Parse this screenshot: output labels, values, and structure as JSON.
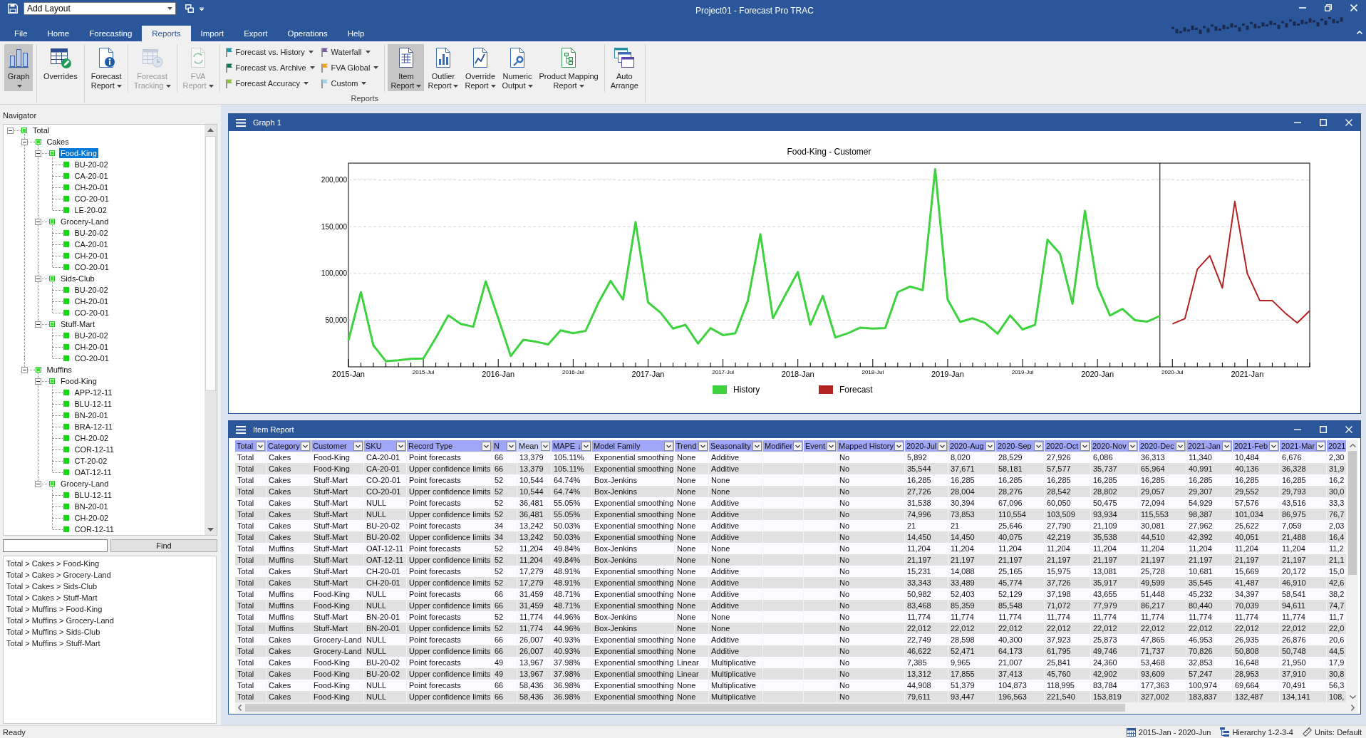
{
  "title_bar": {
    "layout_combo": "Add Layout",
    "title": "Project01 - Forecast Pro TRAC"
  },
  "ribbon": {
    "tabs": [
      {
        "label": "File",
        "selected": false
      },
      {
        "label": "Home",
        "selected": false
      },
      {
        "label": "Forecasting",
        "selected": false
      },
      {
        "label": "Reports",
        "selected": true
      },
      {
        "label": "Import",
        "selected": false
      },
      {
        "label": "Export",
        "selected": false
      },
      {
        "label": "Operations",
        "selected": false
      },
      {
        "label": "Help",
        "selected": false
      }
    ],
    "groups": [
      {
        "sections": [
          [
            {
              "kind": "large",
              "lines": [
                "Graph"
              ],
              "dropdown": true,
              "selected": true,
              "disabled": false
            }
          ]
        ]
      },
      {
        "sections": [
          [
            {
              "kind": "large",
              "lines": [
                "Overrides"
              ],
              "dropdown": false,
              "selected": false,
              "disabled": false
            }
          ]
        ]
      },
      {
        "label": "Reports",
        "sections": [
          [
            {
              "kind": "large",
              "lines": [
                "Forecast",
                "Report"
              ],
              "dropdown": true,
              "selected": false,
              "disabled": false
            }
          ],
          [
            {
              "kind": "large",
              "lines": [
                "Forecast",
                "Tracking"
              ],
              "dropdown": true,
              "selected": false,
              "disabled": true
            }
          ],
          [
            {
              "kind": "large",
              "lines": [
                "FVA",
                "Report"
              ],
              "dropdown": true,
              "selected": false,
              "disabled": true
            }
          ],
          [
            {
              "kind": "stack",
              "entries": [
                {
                  "label": "Forecast vs. History",
                  "color": "#1b9aaa",
                  "dropdown": true
                },
                {
                  "label": "Forecast vs. Archive",
                  "color": "#127a52",
                  "dropdown": true
                },
                {
                  "label": "Forecast Accuracy",
                  "color": "#8cc43c",
                  "dropdown": true
                }
              ]
            },
            {
              "kind": "stack",
              "entries": [
                {
                  "label": "Waterfall",
                  "color": "#7a5aa8",
                  "dropdown": true
                },
                {
                  "label": "FVA Global",
                  "color": "#f2a51f",
                  "dropdown": true
                },
                {
                  "label": "Custom",
                  "color": "#9fd6ea",
                  "dropdown": true
                }
              ]
            }
          ],
          [
            {
              "kind": "large",
              "lines": [
                "Item",
                "Report"
              ],
              "dropdown": true,
              "selected": true,
              "disabled": false
            },
            {
              "kind": "large",
              "lines": [
                "Outlier",
                "Report"
              ],
              "dropdown": true,
              "selected": false,
              "disabled": false
            },
            {
              "kind": "large",
              "lines": [
                "Override",
                "Report"
              ],
              "dropdown": true,
              "selected": false,
              "disabled": false
            },
            {
              "kind": "large",
              "lines": [
                "Numeric",
                "Output"
              ],
              "dropdown": true,
              "selected": false,
              "disabled": false
            },
            {
              "kind": "large",
              "lines": [
                "Product Mapping",
                "Report"
              ],
              "dropdown": true,
              "selected": false,
              "disabled": false
            }
          ],
          [
            {
              "kind": "large",
              "lines": [
                "Auto",
                "Arrange"
              ],
              "dropdown": false,
              "selected": false,
              "disabled": false
            }
          ]
        ]
      }
    ]
  },
  "navigator": {
    "title": "Navigator",
    "tree": [
      {
        "label": "Total",
        "expanded": true,
        "selected": false,
        "children": [
          {
            "label": "Cakes",
            "expanded": true,
            "selected": false,
            "children": [
              {
                "label": "Food-King",
                "expanded": true,
                "selected": true,
                "children": [
                  {
                    "label": "BU-20-02",
                    "selected": false
                  },
                  {
                    "label": "CA-20-01",
                    "selected": false
                  },
                  {
                    "label": "CH-20-01",
                    "selected": false
                  },
                  {
                    "label": "CO-20-01",
                    "selected": false
                  },
                  {
                    "label": "LE-20-02",
                    "selected": false
                  }
                ]
              },
              {
                "label": "Grocery-Land",
                "expanded": true,
                "selected": false,
                "children": [
                  {
                    "label": "BU-20-02",
                    "selected": false
                  },
                  {
                    "label": "CA-20-01",
                    "selected": false
                  },
                  {
                    "label": "CH-20-01",
                    "selected": false
                  },
                  {
                    "label": "CO-20-01",
                    "selected": false
                  }
                ]
              },
              {
                "label": "Sids-Club",
                "expanded": true,
                "selected": false,
                "children": [
                  {
                    "label": "BU-20-02",
                    "selected": false
                  },
                  {
                    "label": "CH-20-01",
                    "selected": false
                  },
                  {
                    "label": "CO-20-01",
                    "selected": false
                  }
                ]
              },
              {
                "label": "Stuff-Mart",
                "expanded": true,
                "selected": false,
                "children": [
                  {
                    "label": "BU-20-02",
                    "selected": false
                  },
                  {
                    "label": "CH-20-01",
                    "selected": false
                  },
                  {
                    "label": "CO-20-01",
                    "selected": false
                  }
                ]
              }
            ]
          },
          {
            "label": "Muffins",
            "expanded": true,
            "selected": false,
            "children": [
              {
                "label": "Food-King",
                "expanded": true,
                "selected": false,
                "children": [
                  {
                    "label": "APP-12-11",
                    "selected": false
                  },
                  {
                    "label": "BLU-12-11",
                    "selected": false
                  },
                  {
                    "label": "BN-20-01",
                    "selected": false
                  },
                  {
                    "label": "BRA-12-11",
                    "selected": false
                  },
                  {
                    "label": "CH-20-02",
                    "selected": false
                  },
                  {
                    "label": "COR-12-11",
                    "selected": false
                  },
                  {
                    "label": "CT-20-02",
                    "selected": false
                  },
                  {
                    "label": "OAT-12-11",
                    "selected": false
                  }
                ]
              },
              {
                "label": "Grocery-Land",
                "expanded": true,
                "selected": false,
                "children": [
                  {
                    "label": "BLU-12-11",
                    "selected": false
                  },
                  {
                    "label": "BN-20-01",
                    "selected": false
                  },
                  {
                    "label": "CH-20-02",
                    "selected": false
                  },
                  {
                    "label": "COR-12-11",
                    "selected": false
                  }
                ]
              }
            ]
          }
        ]
      }
    ],
    "find_button": "Find",
    "paths": [
      "Total > Cakes > Food-King",
      "Total > Cakes > Grocery-Land",
      "Total > Cakes > Sids-Club",
      "Total > Cakes > Stuff-Mart",
      "Total > Muffins > Food-King",
      "Total > Muffins > Grocery-Land",
      "Total > Muffins > Sids-Club",
      "Total > Muffins > Stuff-Mart"
    ]
  },
  "graph": {
    "title": "Graph 1",
    "chart_data": {
      "type": "line",
      "title": "Food-King - Customer",
      "categories": [
        "2015-Jan",
        null,
        null,
        null,
        null,
        null,
        "2015-Jul",
        null,
        null,
        null,
        null,
        null,
        "2016-Jan",
        null,
        null,
        null,
        null,
        null,
        "2016-Jul",
        null,
        null,
        null,
        null,
        null,
        "2017-Jan",
        null,
        null,
        null,
        null,
        null,
        "2017-Jul",
        null,
        null,
        null,
        null,
        null,
        "2018-Jan",
        null,
        null,
        null,
        null,
        null,
        "2018-Jul",
        null,
        null,
        null,
        null,
        null,
        "2019-Jan",
        null,
        null,
        null,
        null,
        null,
        "2019-Jul",
        null,
        null,
        null,
        null,
        null,
        "2020-Jan",
        null,
        null,
        null,
        null,
        null,
        "2020-Jul",
        null,
        null,
        null,
        null,
        null,
        "2021-Jan",
        null,
        null,
        null,
        null,
        null
      ],
      "series": [
        {
          "name": "History",
          "color": "#3ed23e",
          "values": [
            28500,
            80000,
            23000,
            6000,
            7000,
            8500,
            9000,
            31000,
            55000,
            46000,
            43000,
            91500,
            52000,
            11500,
            29000,
            27000,
            24000,
            39000,
            36000,
            38500,
            68000,
            92000,
            72000,
            155000,
            69000,
            58000,
            41000,
            45000,
            25000,
            41500,
            34000,
            36000,
            71000,
            142000,
            52000,
            77000,
            101500,
            45000,
            76000,
            31500,
            36000,
            42000,
            41000,
            41500,
            80000,
            86000,
            82000,
            211500,
            72000,
            48000,
            52000,
            47000,
            35500,
            55000,
            40000,
            45000,
            136000,
            121000,
            67500,
            167000,
            86000,
            55000,
            62000,
            50000,
            48500,
            54500,
            null,
            null,
            null,
            null,
            null,
            null,
            null,
            null,
            null,
            null,
            null,
            null
          ]
        },
        {
          "name": "Forecast",
          "color": "#b22222",
          "values": [
            null,
            null,
            null,
            null,
            null,
            null,
            null,
            null,
            null,
            null,
            null,
            null,
            null,
            null,
            null,
            null,
            null,
            null,
            null,
            null,
            null,
            null,
            null,
            null,
            null,
            null,
            null,
            null,
            null,
            null,
            null,
            null,
            null,
            null,
            null,
            null,
            null,
            null,
            null,
            null,
            null,
            null,
            null,
            null,
            null,
            null,
            null,
            null,
            null,
            null,
            null,
            null,
            null,
            null,
            null,
            null,
            null,
            null,
            null,
            null,
            null,
            null,
            null,
            null,
            null,
            null,
            46000,
            51500,
            104500,
            119000,
            84500,
            177000,
            100000,
            71000,
            71000,
            58000,
            47000,
            60000
          ]
        }
      ],
      "ylim": [
        0,
        218000
      ],
      "yticks": [
        {
          "value": 50000,
          "label": "50,000"
        },
        {
          "value": 100000,
          "label": "100,000"
        },
        {
          "value": 150000,
          "label": "150,000"
        },
        {
          "value": 200000,
          "label": "200,000"
        }
      ],
      "grid": true,
      "legend": "bottom"
    }
  },
  "item_report": {
    "title": "Item Report",
    "columns": [
      {
        "label": "Total",
        "highlighted": false,
        "dropdown": true
      },
      {
        "label": "Category",
        "highlighted": false,
        "dropdown": true
      },
      {
        "label": "Customer",
        "highlighted": false,
        "dropdown": true
      },
      {
        "label": "SKU",
        "highlighted": false,
        "dropdown": true
      },
      {
        "label": "Record Type",
        "highlighted": false,
        "dropdown": true
      },
      {
        "label": "N",
        "highlighted": false,
        "dropdown": true
      },
      {
        "label": "Mean",
        "highlighted": true,
        "dropdown": true
      },
      {
        "label": "MAPE ↓",
        "highlighted": false,
        "dropdown": true
      },
      {
        "label": "Model Family",
        "highlighted": false,
        "dropdown": true
      },
      {
        "label": "Trend",
        "highlighted": false,
        "dropdown": true
      },
      {
        "label": "Seasonality",
        "highlighted": false,
        "dropdown": true
      },
      {
        "label": "Modifier",
        "highlighted": false,
        "dropdown": true
      },
      {
        "label": "Event",
        "highlighted": false,
        "dropdown": true
      },
      {
        "label": "Mapped History",
        "highlighted": false,
        "dropdown": true
      },
      {
        "label": "2020-Jul",
        "highlighted": false,
        "dropdown": true
      },
      {
        "label": "2020-Aug",
        "highlighted": false,
        "dropdown": true
      },
      {
        "label": "2020-Sep",
        "highlighted": false,
        "dropdown": true
      },
      {
        "label": "2020-Oct",
        "highlighted": false,
        "dropdown": true
      },
      {
        "label": "2020-Nov",
        "highlighted": false,
        "dropdown": true
      },
      {
        "label": "2020-Dec",
        "highlighted": false,
        "dropdown": true
      },
      {
        "label": "2021-Jan",
        "highlighted": false,
        "dropdown": true
      },
      {
        "label": "2021-Feb",
        "highlighted": false,
        "dropdown": true
      },
      {
        "label": "2021-Mar",
        "highlighted": false,
        "dropdown": true
      },
      {
        "label": "2021",
        "highlighted": false,
        "dropdown": false
      }
    ],
    "rows": [
      [
        "Total",
        "Cakes",
        "Food-King",
        "CA-20-01",
        "Point forecasts",
        "66",
        "13,379",
        "105.11%",
        "Exponential smoothing",
        "None",
        "Additive",
        null,
        null,
        "No",
        "5,892",
        "8,020",
        "28,529",
        "27,926",
        "6,086",
        "36,313",
        "11,340",
        "10,484",
        "6,676",
        "2,30"
      ],
      [
        "Total",
        "Cakes",
        "Food-King",
        "CA-20-01",
        "Upper confidence limits",
        "66",
        "13,379",
        "105.11%",
        "Exponential smoothing",
        "None",
        "Additive",
        null,
        null,
        "No",
        "35,544",
        "37,671",
        "58,181",
        "57,577",
        "35,737",
        "65,964",
        "40,991",
        "40,136",
        "36,328",
        "31,9"
      ],
      [
        "Total",
        "Cakes",
        "Stuff-Mart",
        "CO-20-01",
        "Point forecasts",
        "52",
        "10,544",
        "64.74%",
        "Box-Jenkins",
        "None",
        "None",
        null,
        null,
        "No",
        "16,285",
        "16,285",
        "16,285",
        "16,285",
        "16,285",
        "16,285",
        "16,285",
        "16,285",
        "16,285",
        "16,2"
      ],
      [
        "Total",
        "Cakes",
        "Stuff-Mart",
        "CO-20-01",
        "Upper confidence limits",
        "52",
        "10,544",
        "64.74%",
        "Box-Jenkins",
        "None",
        "None",
        null,
        null,
        "No",
        "27,726",
        "28,004",
        "28,276",
        "28,542",
        "28,802",
        "29,057",
        "29,307",
        "29,552",
        "29,793",
        "30,0"
      ],
      [
        "Total",
        "Cakes",
        "Stuff-Mart",
        "NULL",
        "Point forecasts",
        "52",
        "36,481",
        "55.05%",
        "Exponential smoothing",
        "None",
        "Additive",
        null,
        null,
        "No",
        "31,538",
        "30,394",
        "67,096",
        "60,050",
        "50,475",
        "72,094",
        "54,929",
        "57,576",
        "43,516",
        "33,3"
      ],
      [
        "Total",
        "Cakes",
        "Stuff-Mart",
        "NULL",
        "Upper confidence limits",
        "52",
        "36,481",
        "55.05%",
        "Exponential smoothing",
        "None",
        "Additive",
        null,
        null,
        "No",
        "74,996",
        "73,853",
        "110,554",
        "103,509",
        "93,934",
        "115,553",
        "98,387",
        "101,034",
        "86,975",
        "76,7"
      ],
      [
        "Total",
        "Cakes",
        "Stuff-Mart",
        "BU-20-02",
        "Point forecasts",
        "34",
        "13,242",
        "50.03%",
        "Exponential smoothing",
        "None",
        "Additive",
        null,
        null,
        "No",
        "21",
        "21",
        "25,646",
        "27,790",
        "21,109",
        "30,081",
        "27,962",
        "25,622",
        "7,059",
        "2,03"
      ],
      [
        "Total",
        "Cakes",
        "Stuff-Mart",
        "BU-20-02",
        "Upper confidence limits",
        "34",
        "13,242",
        "50.03%",
        "Exponential smoothing",
        "None",
        "Additive",
        null,
        null,
        "No",
        "14,450",
        "14,450",
        "40,075",
        "42,219",
        "35,538",
        "44,510",
        "42,392",
        "40,051",
        "21,488",
        "16,4"
      ],
      [
        "Total",
        "Muffins",
        "Stuff-Mart",
        "OAT-12-11",
        "Point forecasts",
        "52",
        "11,204",
        "49.84%",
        "Box-Jenkins",
        "None",
        "None",
        null,
        null,
        "No",
        "11,204",
        "11,204",
        "11,204",
        "11,204",
        "11,204",
        "11,204",
        "11,204",
        "11,204",
        "11,204",
        "11,2"
      ],
      [
        "Total",
        "Muffins",
        "Stuff-Mart",
        "OAT-12-11",
        "Upper confidence limits",
        "52",
        "11,204",
        "49.84%",
        "Box-Jenkins",
        "None",
        "None",
        null,
        null,
        "No",
        "21,197",
        "21,197",
        "21,197",
        "21,197",
        "21,197",
        "21,197",
        "21,197",
        "21,197",
        "21,197",
        "21,1"
      ],
      [
        "Total",
        "Cakes",
        "Stuff-Mart",
        "CH-20-01",
        "Point forecasts",
        "52",
        "17,279",
        "48.91%",
        "Exponential smoothing",
        "None",
        "Additive",
        null,
        null,
        "No",
        "15,231",
        "14,088",
        "25,165",
        "15,975",
        "13,081",
        "25,728",
        "10,681",
        "15,669",
        "20,172",
        "15,0"
      ],
      [
        "Total",
        "Cakes",
        "Stuff-Mart",
        "CH-20-01",
        "Upper confidence limits",
        "52",
        "17,279",
        "48.91%",
        "Exponential smoothing",
        "None",
        "Additive",
        null,
        null,
        "No",
        "33,343",
        "33,489",
        "45,774",
        "37,726",
        "35,917",
        "49,599",
        "35,545",
        "41,487",
        "46,910",
        "42,6"
      ],
      [
        "Total",
        "Muffins",
        "Food-King",
        "NULL",
        "Point forecasts",
        "66",
        "31,459",
        "48.71%",
        "Exponential smoothing",
        "None",
        "Additive",
        null,
        null,
        "No",
        "50,982",
        "52,403",
        "52,129",
        "37,198",
        "43,655",
        "51,448",
        "45,232",
        "34,397",
        "58,541",
        "38,2"
      ],
      [
        "Total",
        "Muffins",
        "Food-King",
        "NULL",
        "Upper confidence limits",
        "66",
        "31,459",
        "48.71%",
        "Exponential smoothing",
        "None",
        "Additive",
        null,
        null,
        "No",
        "83,468",
        "85,359",
        "85,548",
        "71,072",
        "77,979",
        "86,217",
        "80,440",
        "70,039",
        "94,611",
        "74,7"
      ],
      [
        "Total",
        "Muffins",
        "Stuff-Mart",
        "BN-20-01",
        "Point forecasts",
        "52",
        "11,774",
        "44.96%",
        "Box-Jenkins",
        "None",
        "None",
        null,
        null,
        "No",
        "11,774",
        "11,774",
        "11,774",
        "11,774",
        "11,774",
        "11,774",
        "11,774",
        "11,774",
        "11,774",
        "11,7"
      ],
      [
        "Total",
        "Muffins",
        "Stuff-Mart",
        "BN-20-01",
        "Upper confidence limits",
        "52",
        "11,774",
        "44.96%",
        "Box-Jenkins",
        "None",
        "None",
        null,
        null,
        "No",
        "22,012",
        "22,012",
        "22,012",
        "22,012",
        "22,012",
        "22,012",
        "22,012",
        "22,012",
        "22,012",
        "22,0"
      ],
      [
        "Total",
        "Cakes",
        "Grocery-Land",
        "NULL",
        "Point forecasts",
        "66",
        "26,007",
        "40.93%",
        "Exponential smoothing",
        "None",
        "Additive",
        null,
        null,
        "No",
        "22,749",
        "28,598",
        "40,300",
        "37,923",
        "25,873",
        "47,865",
        "46,953",
        "26,935",
        "26,876",
        "20,6"
      ],
      [
        "Total",
        "Cakes",
        "Grocery-Land",
        "NULL",
        "Upper confidence limits",
        "66",
        "26,007",
        "40.93%",
        "Exponential smoothing",
        "None",
        "Additive",
        null,
        null,
        "No",
        "46,622",
        "52,471",
        "64,173",
        "61,795",
        "49,746",
        "71,737",
        "70,826",
        "50,808",
        "50,748",
        "44,5"
      ],
      [
        "Total",
        "Cakes",
        "Food-King",
        "BU-20-02",
        "Point forecasts",
        "49",
        "13,967",
        "37.98%",
        "Exponential smoothing",
        "Linear",
        "Multiplicative",
        null,
        null,
        "No",
        "7,385",
        "9,965",
        "21,007",
        "25,841",
        "24,360",
        "53,468",
        "32,853",
        "16,648",
        "21,950",
        "17,9"
      ],
      [
        "Total",
        "Cakes",
        "Food-King",
        "BU-20-02",
        "Upper confidence limits",
        "49",
        "13,967",
        "37.98%",
        "Exponential smoothing",
        "Linear",
        "Multiplicative",
        null,
        null,
        "No",
        "13,312",
        "17,855",
        "37,413",
        "45,760",
        "42,902",
        "93,609",
        "57,247",
        "28,953",
        "37,910",
        "30,8"
      ],
      [
        "Total",
        "Cakes",
        "Food-King",
        "NULL",
        "Point forecasts",
        "66",
        "58,436",
        "36.98%",
        "Exponential smoothing",
        "None",
        "Multiplicative",
        null,
        null,
        "No",
        "44,908",
        "51,379",
        "104,873",
        "118,995",
        "83,784",
        "177,363",
        "100,974",
        "69,664",
        "70,491",
        "56,3"
      ],
      [
        "Total",
        "Cakes",
        "Food-King",
        "NULL",
        "Upper confidence limits",
        "66",
        "58,436",
        "36.98%",
        "Exponential smoothing",
        "None",
        "Multiplicative",
        null,
        null,
        "No",
        "79,611",
        "93,447",
        "196,563",
        "221,540",
        "153,819",
        "327,002",
        "183,837",
        "132,487",
        "134,141",
        "108,"
      ]
    ]
  },
  "status_bar": {
    "message": "Ready",
    "date_range": "2015-Jan - 2020-Jun",
    "hierarchy": "Hierarchy 1-2-3-4",
    "units": "Units: Default"
  }
}
